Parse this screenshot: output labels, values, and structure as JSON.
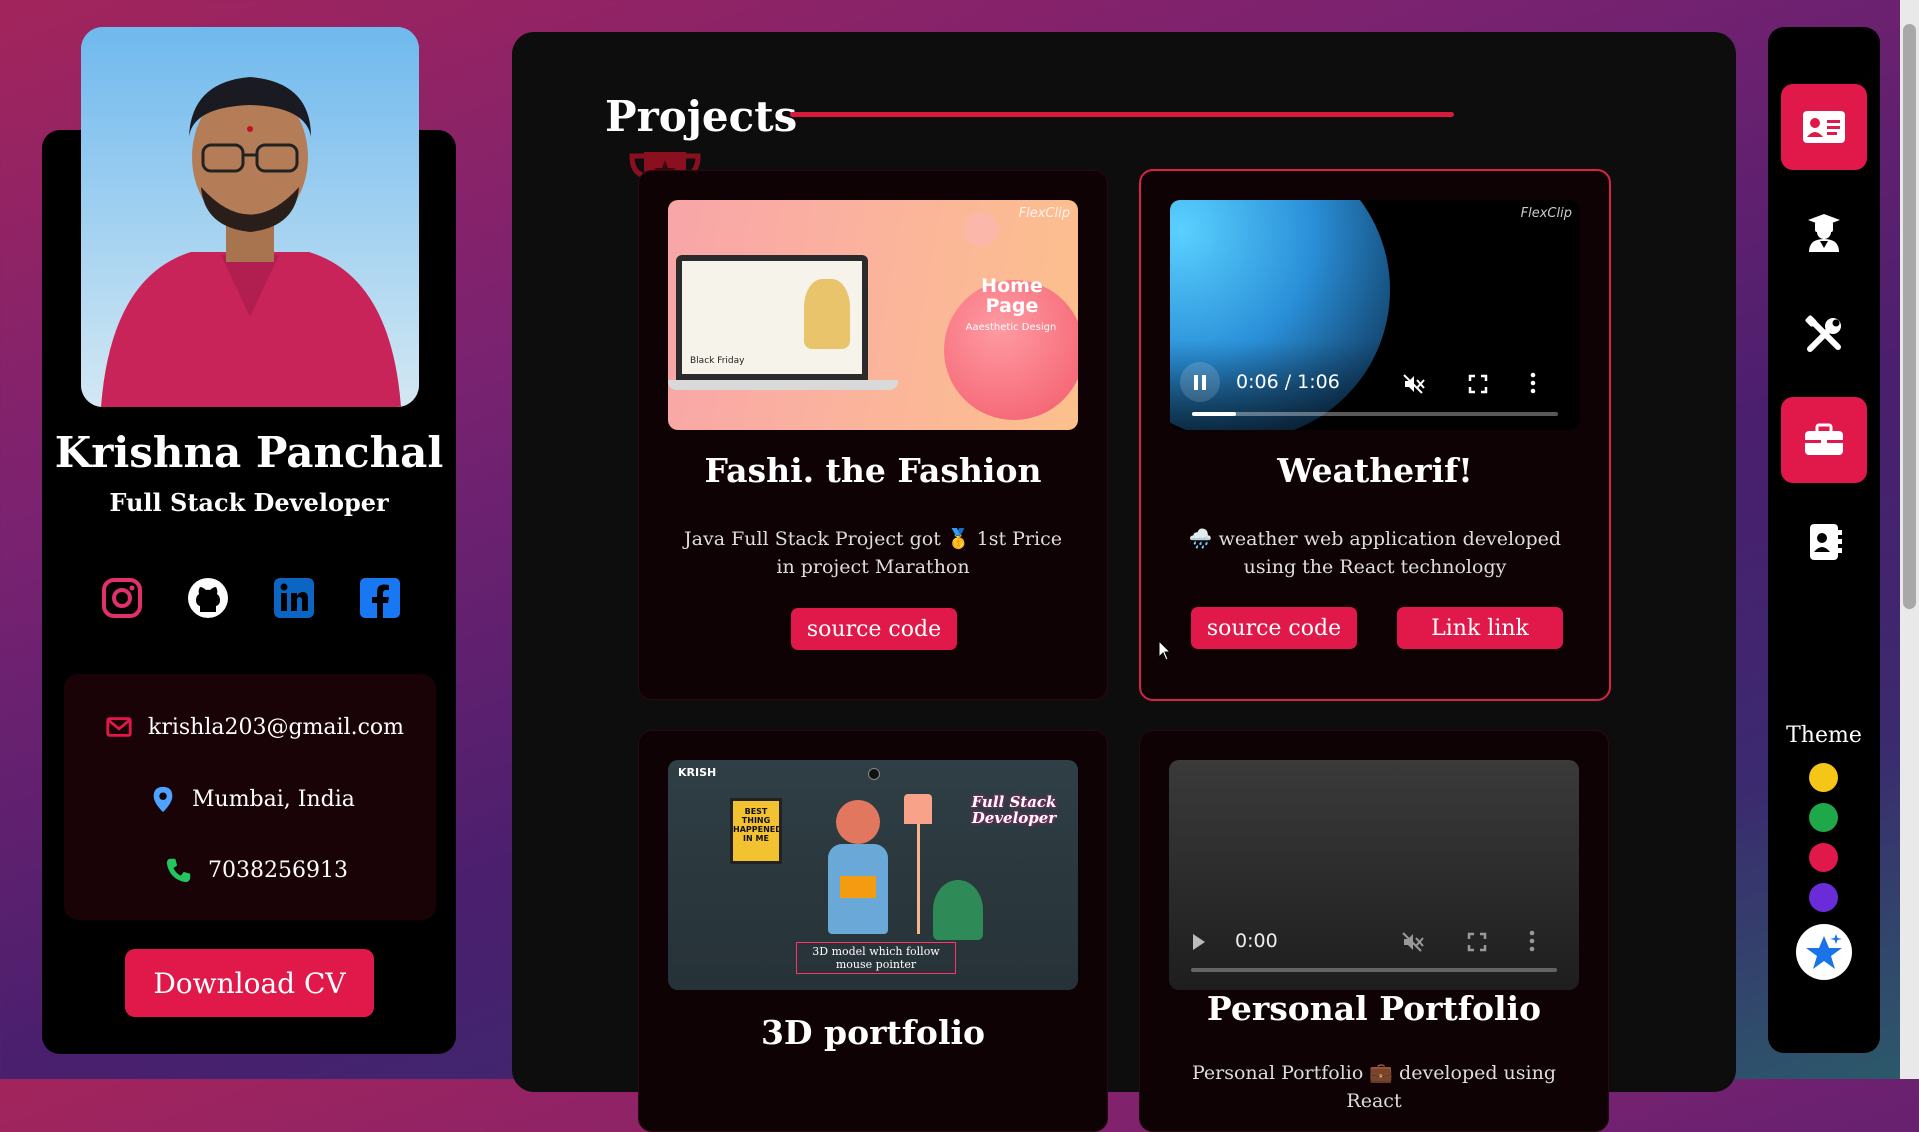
{
  "profile": {
    "name": "Krishna Panchal",
    "role": "Full Stack Developer",
    "photo_alt": "profile-photo",
    "socials": [
      "instagram",
      "github",
      "linkedin",
      "facebook"
    ],
    "contact": {
      "email": "krishla203@gmail.com",
      "location": "Mumbai, India",
      "phone": "7038256913"
    },
    "download_label": "Download CV"
  },
  "main": {
    "section_title": "Projects",
    "projects": [
      {
        "title": "Fashi. the Fashion",
        "desc": "Java Full Stack Project got 🥇 1st Price in project Marathon",
        "buttons": [
          "source code"
        ],
        "media": {
          "watermark": "FlexClip",
          "heading": "Home Page",
          "sub": "Aaesthetic Design",
          "badge": "Black Friday"
        }
      },
      {
        "title": "Weatherif!",
        "desc": "🌧️ weather web application developed using the React technology",
        "buttons": [
          "source code",
          "Link link"
        ],
        "media": {
          "watermark": "FlexClip",
          "time": "0:06 / 1:06",
          "progress": 0.12,
          "state": "playing"
        }
      },
      {
        "title": "3D portfolio",
        "desc": "",
        "buttons": [],
        "media": {
          "brand": "KRISH",
          "poster": "BEST THING HAPPENED IN ME",
          "script": "Full Stack Developer",
          "caption": "3D model which follow mouse pointer"
        }
      },
      {
        "title": "Personal Portfolio",
        "desc": "Personal Portfolio 💼 developed using React",
        "buttons": [],
        "media": {
          "time": "0:00",
          "progress": 0,
          "state": "paused"
        }
      }
    ]
  },
  "nav": {
    "items": [
      "about-card",
      "education",
      "skills-tools",
      "projects-briefcase",
      "contact-card"
    ],
    "active": [
      "about-card",
      "projects-briefcase"
    ],
    "theme_label": "Theme",
    "theme_colors": [
      "#f5c518",
      "#1ea84a",
      "#e0194a",
      "#6a2cd8"
    ]
  },
  "colors": {
    "accent": "#e0194a",
    "panel": "#0d0d0d",
    "card": "#0f0204"
  }
}
